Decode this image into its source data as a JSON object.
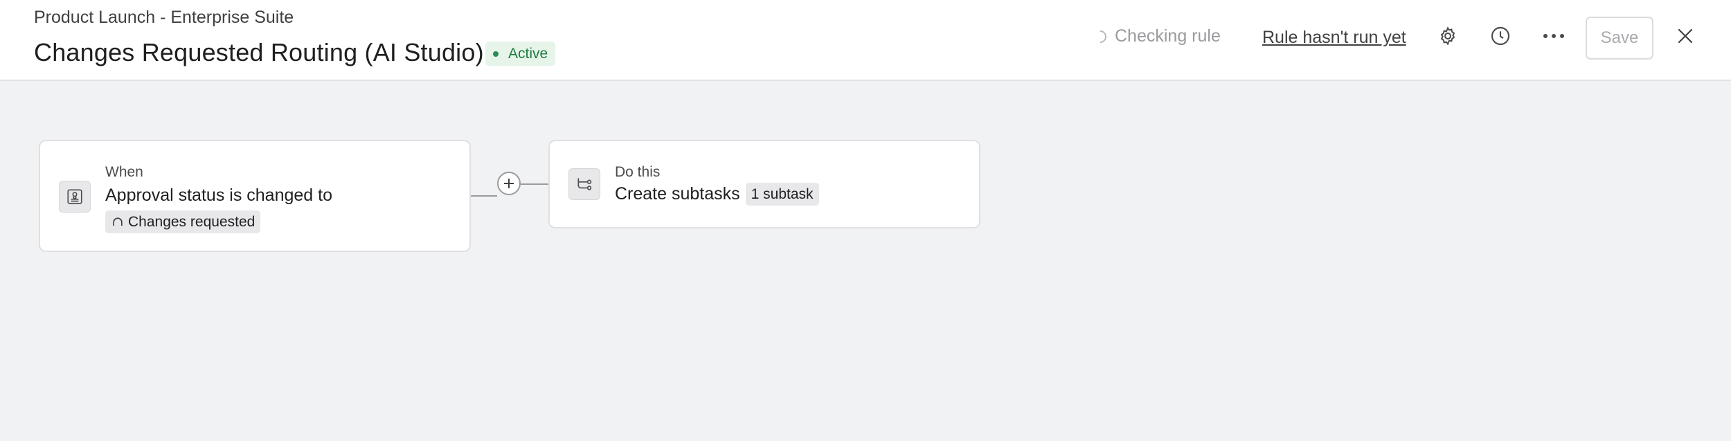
{
  "header": {
    "breadcrumb": "Product Launch - Enterprise Suite",
    "title": "Changes Requested Routing (AI Studio)",
    "status_badge": "Active",
    "checking_label": "Checking rule",
    "run_status_link": "Rule hasn't run yet",
    "save_label": "Save",
    "icons": [
      "gear-icon",
      "clock-icon",
      "more-icon",
      "close-icon"
    ]
  },
  "canvas": {
    "trigger_card": {
      "kicker": "When",
      "title": "Approval status is changed to",
      "chip_label": "Changes requested",
      "icon": "approval-stamp-icon"
    },
    "action_card": {
      "kicker": "Do this",
      "title": "Create subtasks",
      "chip_label": "1 subtask",
      "icon": "subtasks-icon"
    },
    "add_step_icon": "plus-icon"
  },
  "colors": {
    "canvas_bg": "#f1f2f3",
    "active_badge_bg": "#e7f4ea",
    "active_text": "#1f7a3f"
  }
}
